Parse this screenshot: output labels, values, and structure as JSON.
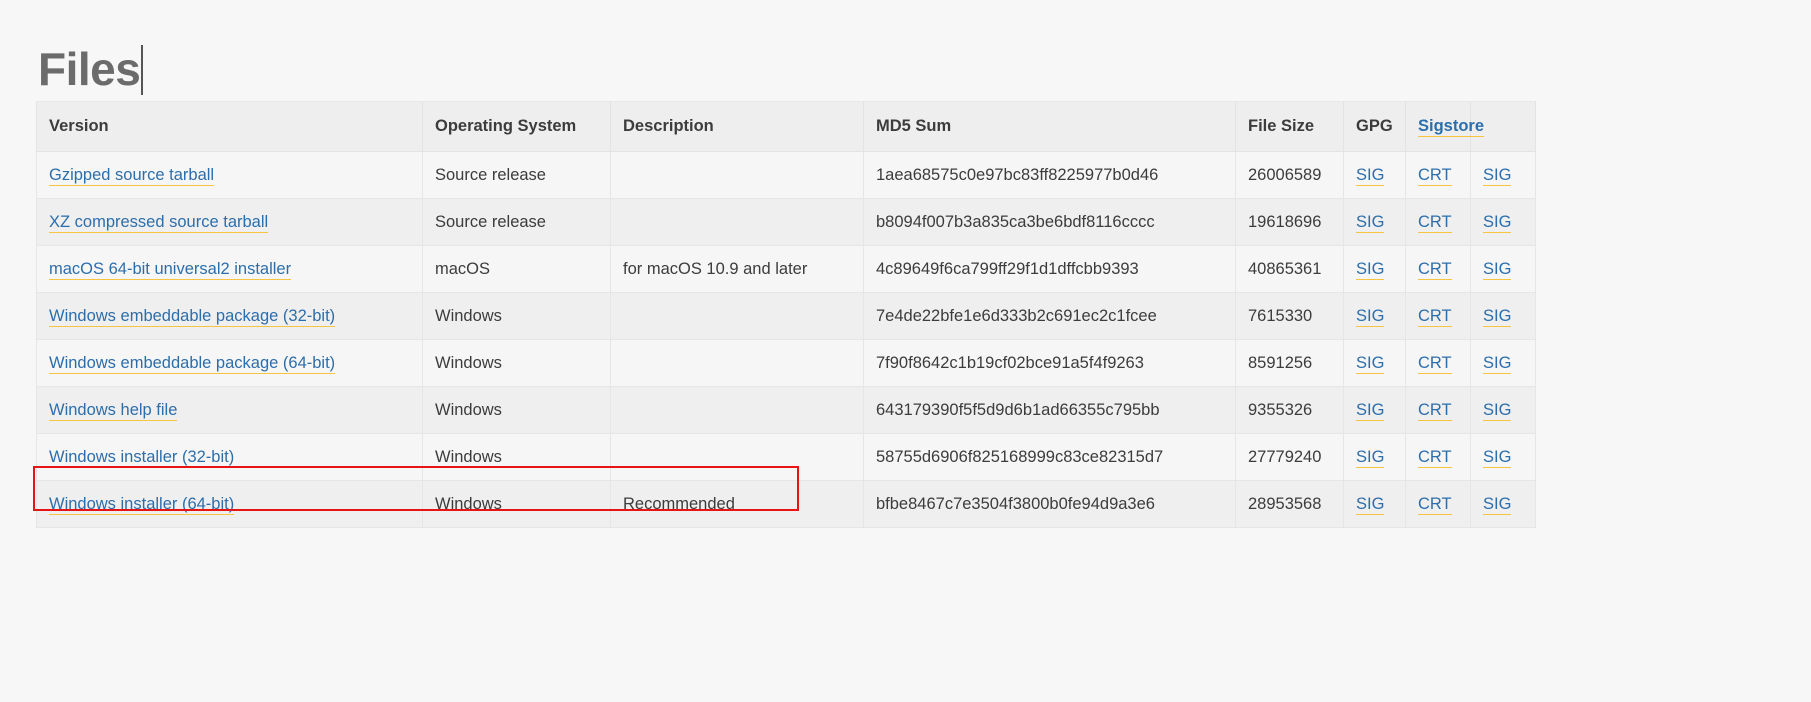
{
  "page": {
    "title": "Files",
    "background_color": "#f7f7f7",
    "link_color": "#2c6eab",
    "link_underline_color": "#f5c542",
    "highlight_color": "#e81313"
  },
  "table": {
    "headers": [
      {
        "label": "Version",
        "is_link": false
      },
      {
        "label": "Operating System",
        "is_link": false
      },
      {
        "label": "Description",
        "is_link": false
      },
      {
        "label": "MD5 Sum",
        "is_link": false
      },
      {
        "label": "File Size",
        "is_link": false
      },
      {
        "label": "GPG",
        "is_link": false
      },
      {
        "label": "Sigstore",
        "is_link": true
      },
      {
        "label": "",
        "is_link": false
      }
    ],
    "rows": [
      {
        "version": "Gzipped source tarball",
        "os": "Source release",
        "description": "",
        "md5": "1aea68575c0e97bc83ff8225977b0d46",
        "size": "26006589",
        "gpg": "SIG",
        "sigstore_crt": "CRT",
        "sigstore_sig": "SIG"
      },
      {
        "version": "XZ compressed source tarball",
        "os": "Source release",
        "description": "",
        "md5": "b8094f007b3a835ca3be6bdf8116cccc",
        "size": "19618696",
        "gpg": "SIG",
        "sigstore_crt": "CRT",
        "sigstore_sig": "SIG"
      },
      {
        "version": "macOS 64-bit universal2 installer",
        "os": "macOS",
        "description": "for macOS 10.9 and later",
        "md5": "4c89649f6ca799ff29f1d1dffcbb9393",
        "size": "40865361",
        "gpg": "SIG",
        "sigstore_crt": "CRT",
        "sigstore_sig": "SIG"
      },
      {
        "version": "Windows embeddable package (32-bit)",
        "os": "Windows",
        "description": "",
        "md5": "7e4de22bfe1e6d333b2c691ec2c1fcee",
        "size": "7615330",
        "gpg": "SIG",
        "sigstore_crt": "CRT",
        "sigstore_sig": "SIG"
      },
      {
        "version": "Windows embeddable package (64-bit)",
        "os": "Windows",
        "description": "",
        "md5": "7f90f8642c1b19cf02bce91a5f4f9263",
        "size": "8591256",
        "gpg": "SIG",
        "sigstore_crt": "CRT",
        "sigstore_sig": "SIG"
      },
      {
        "version": "Windows help file",
        "os": "Windows",
        "description": "",
        "md5": "643179390f5f5d9d6b1ad66355c795bb",
        "size": "9355326",
        "gpg": "SIG",
        "sigstore_crt": "CRT",
        "sigstore_sig": "SIG"
      },
      {
        "version": "Windows installer (32-bit)",
        "os": "Windows",
        "description": "",
        "md5": "58755d6906f825168999c83ce82315d7",
        "size": "27779240",
        "gpg": "SIG",
        "sigstore_crt": "CRT",
        "sigstore_sig": "SIG"
      },
      {
        "version": "Windows installer (64-bit)",
        "os": "Windows",
        "description": "Recommended",
        "md5": "bfbe8467c7e3504f3800b0fe94d9a3e6",
        "size": "28953568",
        "gpg": "SIG",
        "sigstore_crt": "CRT",
        "sigstore_sig": "SIG"
      }
    ]
  }
}
